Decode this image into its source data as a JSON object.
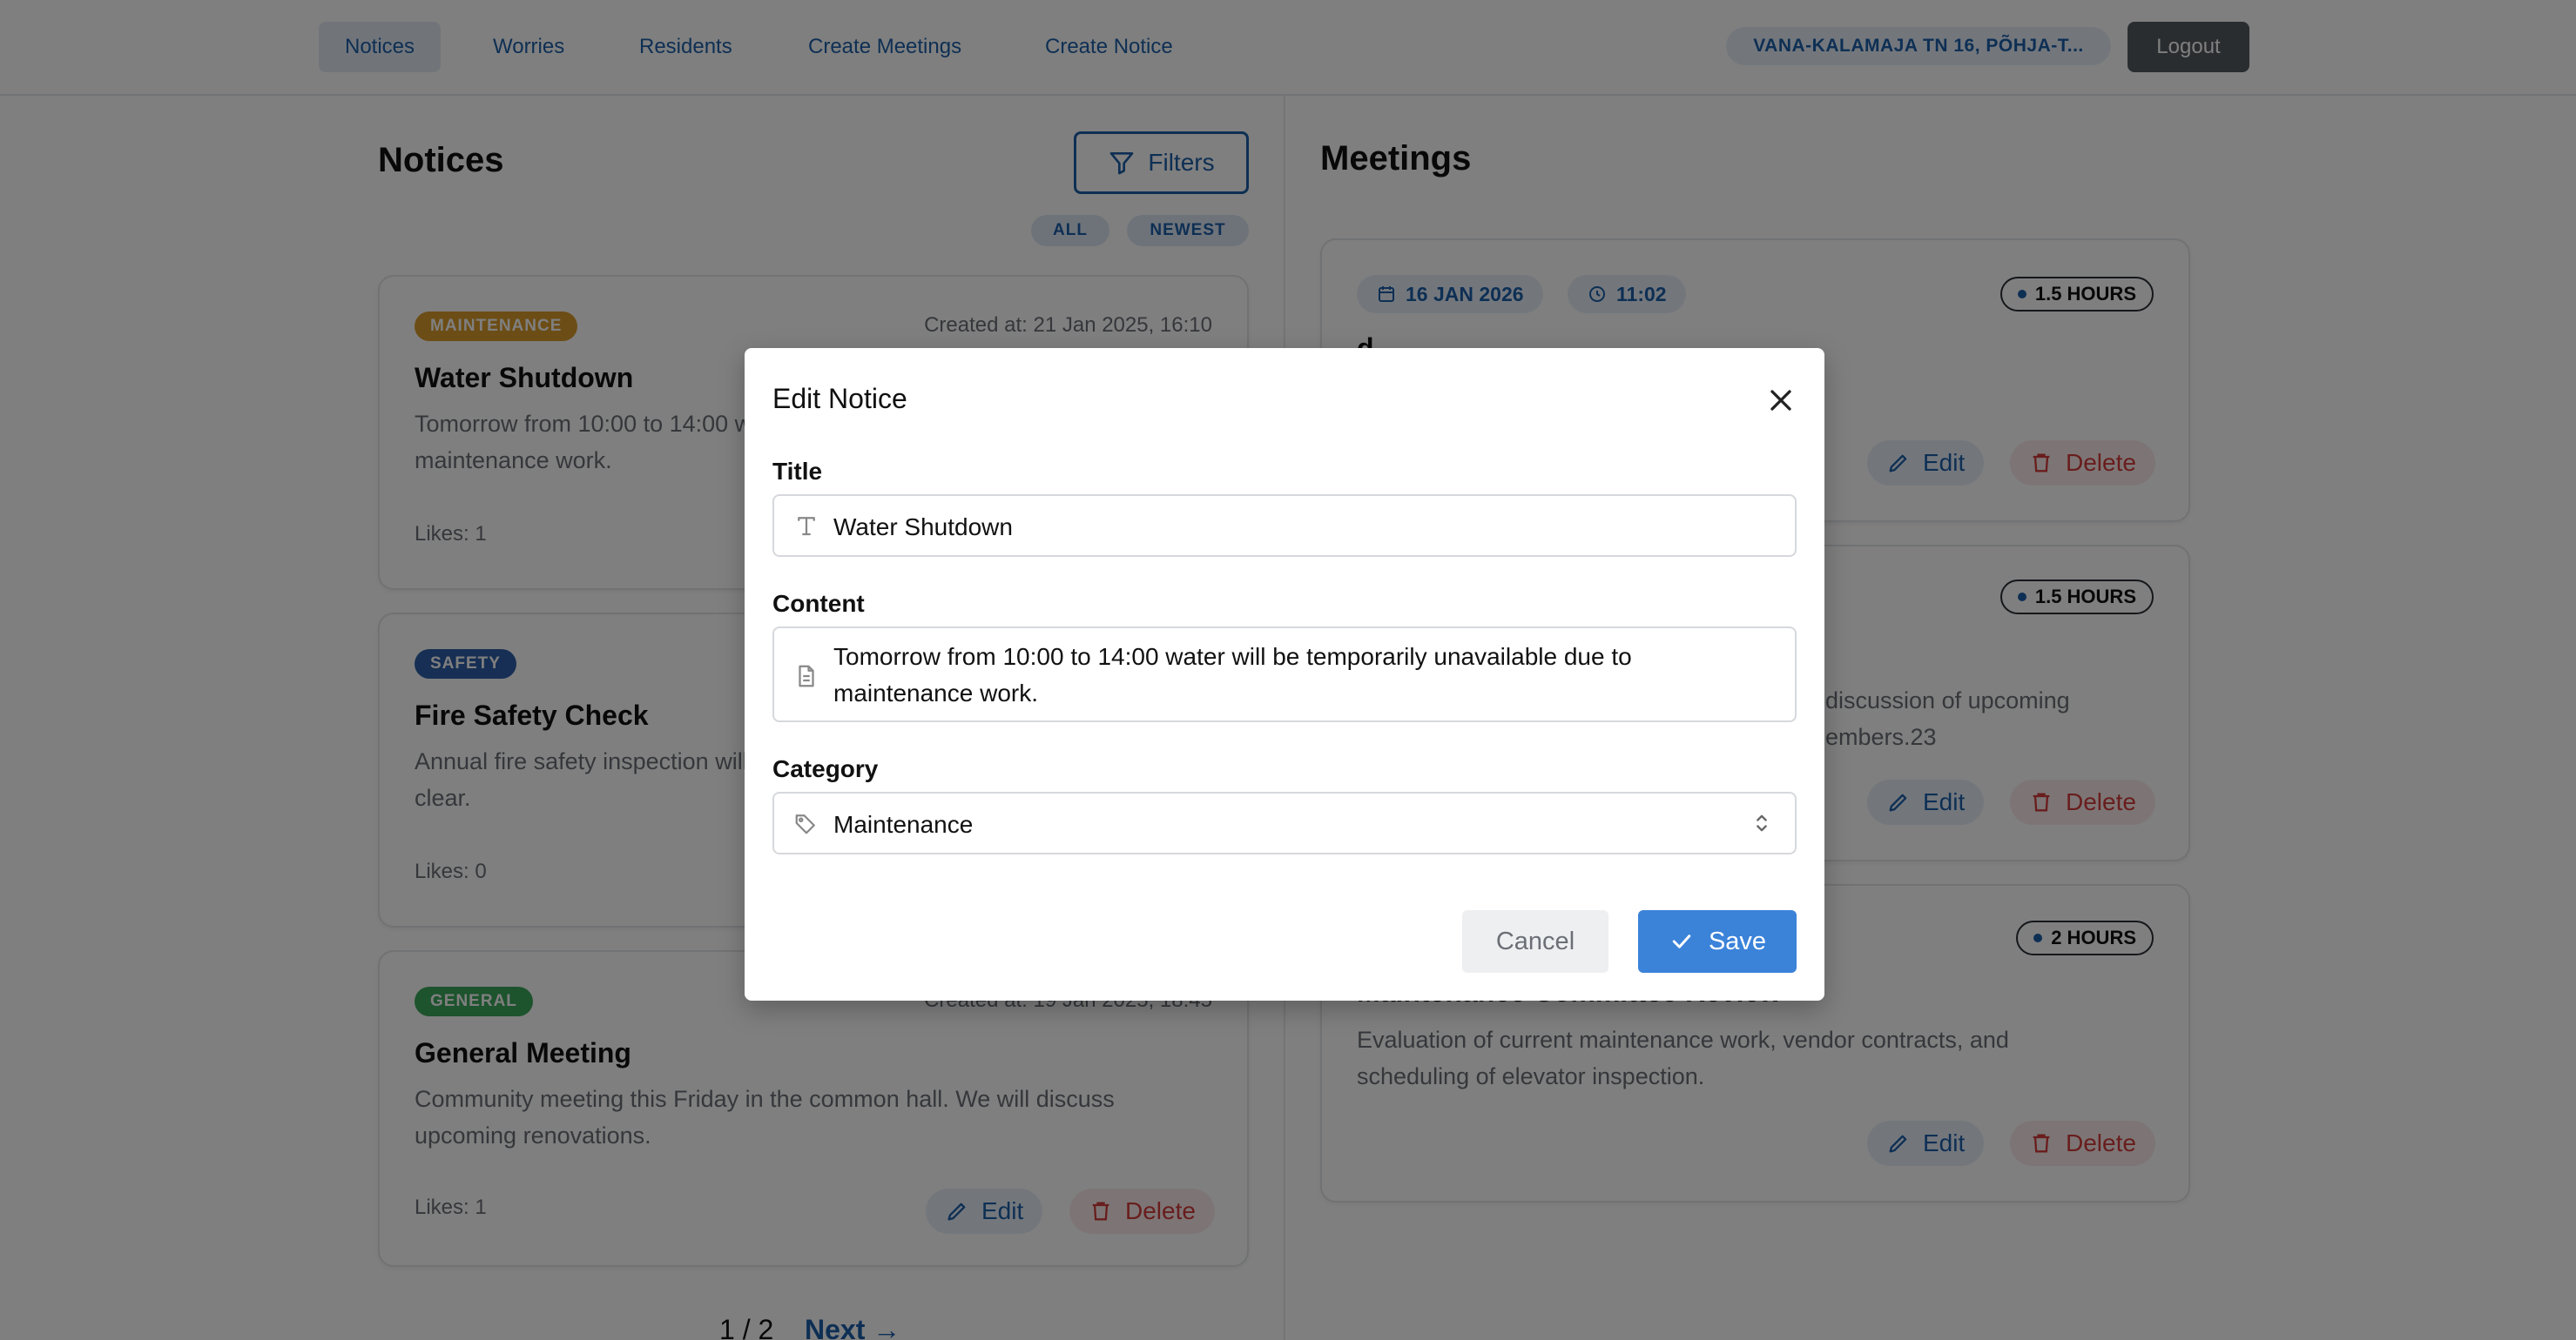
{
  "navbar": {
    "links": [
      "Notices",
      "Worries",
      "Residents",
      "Create Meetings",
      "Create Notice"
    ],
    "address": "VANA-KALAMAJA TN 16, PÕHJA-T...",
    "logout": "Logout"
  },
  "notices": {
    "title": "Notices",
    "filters_label": "Filters",
    "chips": [
      "ALL",
      "NEWEST"
    ],
    "items": [
      {
        "category": "MAINTENANCE",
        "category_color": "#d89a2a",
        "created": "Created at: 21 Jan 2025, 16:10",
        "title": "Water Shutdown",
        "text": "Tomorrow from 10:00 to 14:00 water will be temporarily unavailable due to maintenance work.",
        "likes": "Likes: 1"
      },
      {
        "category": "SAFETY",
        "category_color": "#2f5fa8",
        "created": "",
        "title": "Fire Safety Check",
        "text": "Annual fire safety inspection will take place. Please ensure corridors are clear.",
        "likes": "Likes: 0"
      },
      {
        "category": "GENERAL",
        "category_color": "#3aa65a",
        "created": "Created at: 19 Jan 2025, 18:45",
        "title": "General Meeting",
        "text": "Community meeting this Friday in the common hall. We will discuss upcoming renovations.",
        "likes": "Likes: 1"
      }
    ],
    "edit_label": "Edit",
    "delete_label": "Delete",
    "pager": "1 / 2",
    "next": "Next →"
  },
  "meetings": {
    "title": "Meetings",
    "items": [
      {
        "date": "16 JAN 2026",
        "time": "11:02",
        "duration": "1.5 HOURS",
        "title": "d",
        "text": ""
      },
      {
        "duration": "1.5 HOURS",
        "title": "",
        "text": "discussion of upcoming",
        "text2": "embers.23"
      },
      {
        "duration": "2 HOURS",
        "title": "Maintenance Committee Review",
        "text": "Evaluation of current maintenance work, vendor contracts, and scheduling of elevator inspection."
      }
    ],
    "edit_label": "Edit",
    "delete_label": "Delete"
  },
  "modal": {
    "title": "Edit Notice",
    "title_label": "Title",
    "title_value": "Water Shutdown",
    "content_label": "Content",
    "content_value": "Tomorrow from 10:00 to 14:00 water will be temporarily unavailable due to maintenance work.",
    "category_label": "Category",
    "category_value": "Maintenance",
    "cancel": "Cancel",
    "save": "Save"
  },
  "colors": {
    "primary": "#1d5fa8",
    "save": "#3b82d9",
    "danger": "#d23b3b"
  }
}
